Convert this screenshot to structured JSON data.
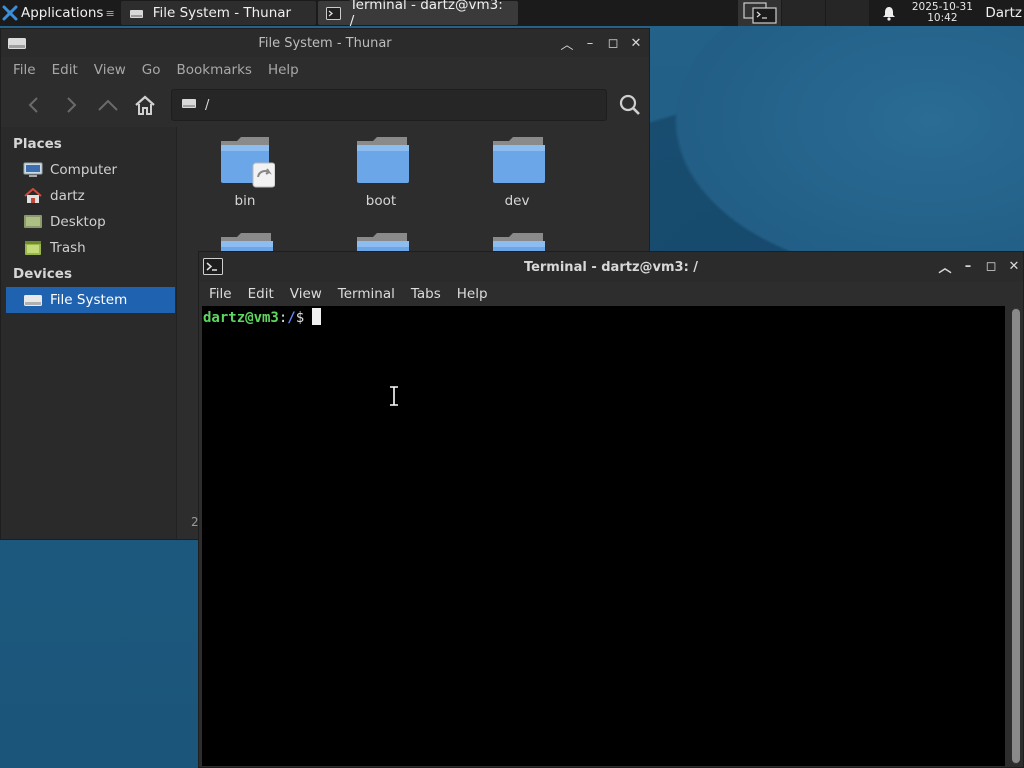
{
  "panel": {
    "applications_label": "Applications",
    "tasks": [
      {
        "label": "File System - Thunar"
      },
      {
        "label": "Terminal - dartz@vm3: /"
      }
    ],
    "clock_date": "2025-10-31",
    "clock_time": "10:42",
    "user": "Dartz"
  },
  "thunar": {
    "title": "File System - Thunar",
    "menu": [
      "File",
      "Edit",
      "View",
      "Go",
      "Bookmarks",
      "Help"
    ],
    "location": "/",
    "sidebar": {
      "places_heading": "Places",
      "places": [
        "Computer",
        "dartz",
        "Desktop",
        "Trash"
      ],
      "devices_heading": "Devices",
      "devices": [
        "File System"
      ]
    },
    "files": [
      "bin",
      "boot",
      "dev"
    ],
    "status_partial": "2"
  },
  "terminal": {
    "title": "Terminal - dartz@vm3: /",
    "menu": [
      "File",
      "Edit",
      "View",
      "Terminal",
      "Tabs",
      "Help"
    ],
    "prompt_user": "dartz@vm3",
    "prompt_colon": ":",
    "prompt_path": "/",
    "prompt_symbol": "$"
  },
  "colors": {
    "selection": "#1f62b0",
    "prompt_user": "#5fd75f",
    "prompt_path": "#5f87ff",
    "folder_blue": "#6aa6e8"
  }
}
